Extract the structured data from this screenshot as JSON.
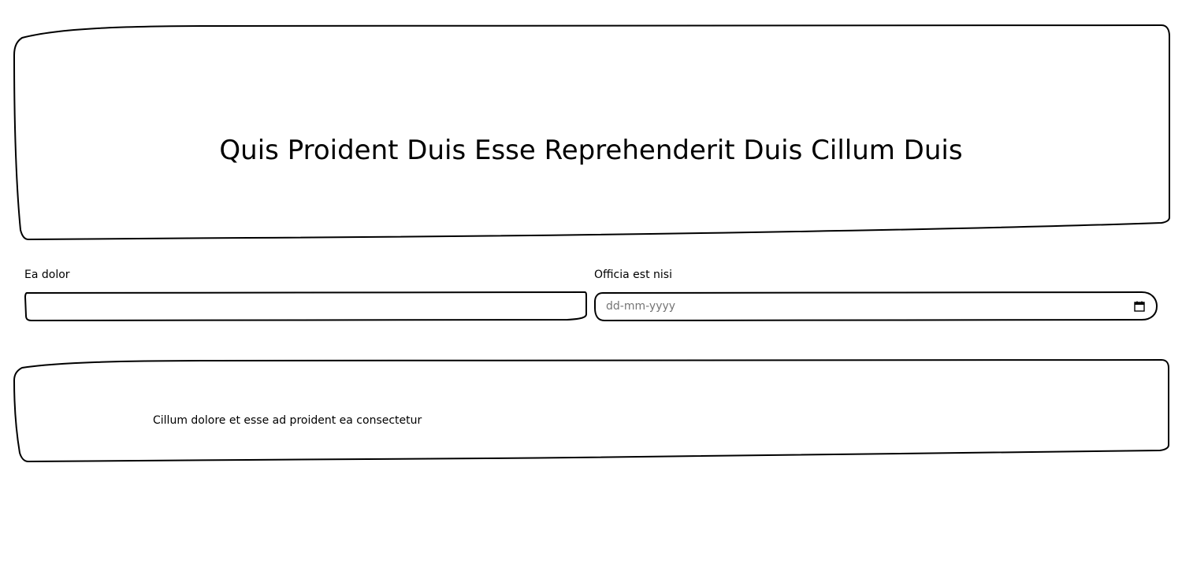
{
  "hero": {
    "title": "Quis Proident Duis Esse Reprehenderit Duis Cillum Duis"
  },
  "form": {
    "field1": {
      "label": "Ea dolor",
      "value": "",
      "placeholder": ""
    },
    "field2": {
      "label": "Officia est nisi",
      "placeholder": "dd-mm-yyyy",
      "icon": "calendar-icon"
    }
  },
  "content": {
    "text": "Cillum dolore et esse ad proident ea consectetur"
  },
  "colors": {
    "stroke": "#000000",
    "background": "#ffffff"
  }
}
